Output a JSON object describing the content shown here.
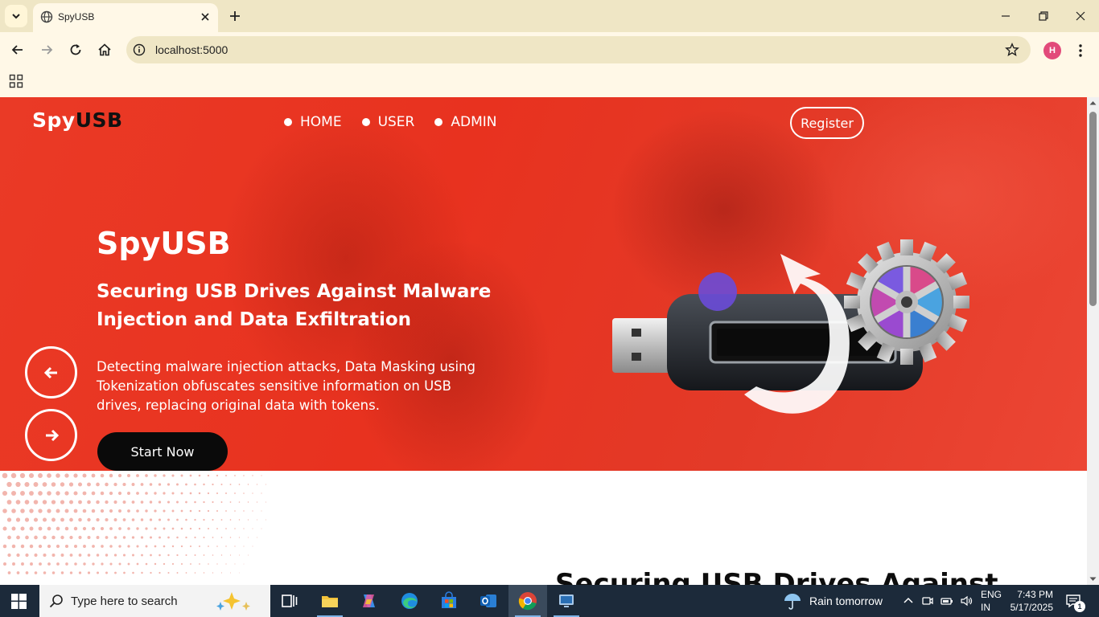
{
  "browser": {
    "tab_title": "SpyUSB",
    "url": "localhost:5000",
    "profile_initial": "H"
  },
  "site": {
    "logo_part1": "Spy",
    "logo_part2": "USB",
    "nav": [
      {
        "label": "HOME"
      },
      {
        "label": "USER"
      },
      {
        "label": "ADMIN"
      }
    ],
    "register_label": "Register"
  },
  "hero": {
    "title": "SpyUSB",
    "subtitle": "Securing USB Drives Against Malware Injection and Data Exfiltration",
    "description": "Detecting malware injection attacks, Data Masking using Tokenization obfuscates sensitive information on USB drives, replacing original data with tokens.",
    "cta_label": "Start Now"
  },
  "section": {
    "title": "Securing USB Drives Against"
  },
  "taskbar": {
    "search_placeholder": "Type here to search",
    "weather": "Rain tomorrow",
    "lang_line1": "ENG",
    "lang_line2": "IN",
    "time": "7:43 PM",
    "date": "5/17/2025",
    "notification_count": "1"
  },
  "colors": {
    "hero_red": "#e8321f",
    "chrome_bg": "#fff8e7",
    "tabbar_bg": "#efe6c5",
    "taskbar_bg": "#1c2a3a"
  }
}
